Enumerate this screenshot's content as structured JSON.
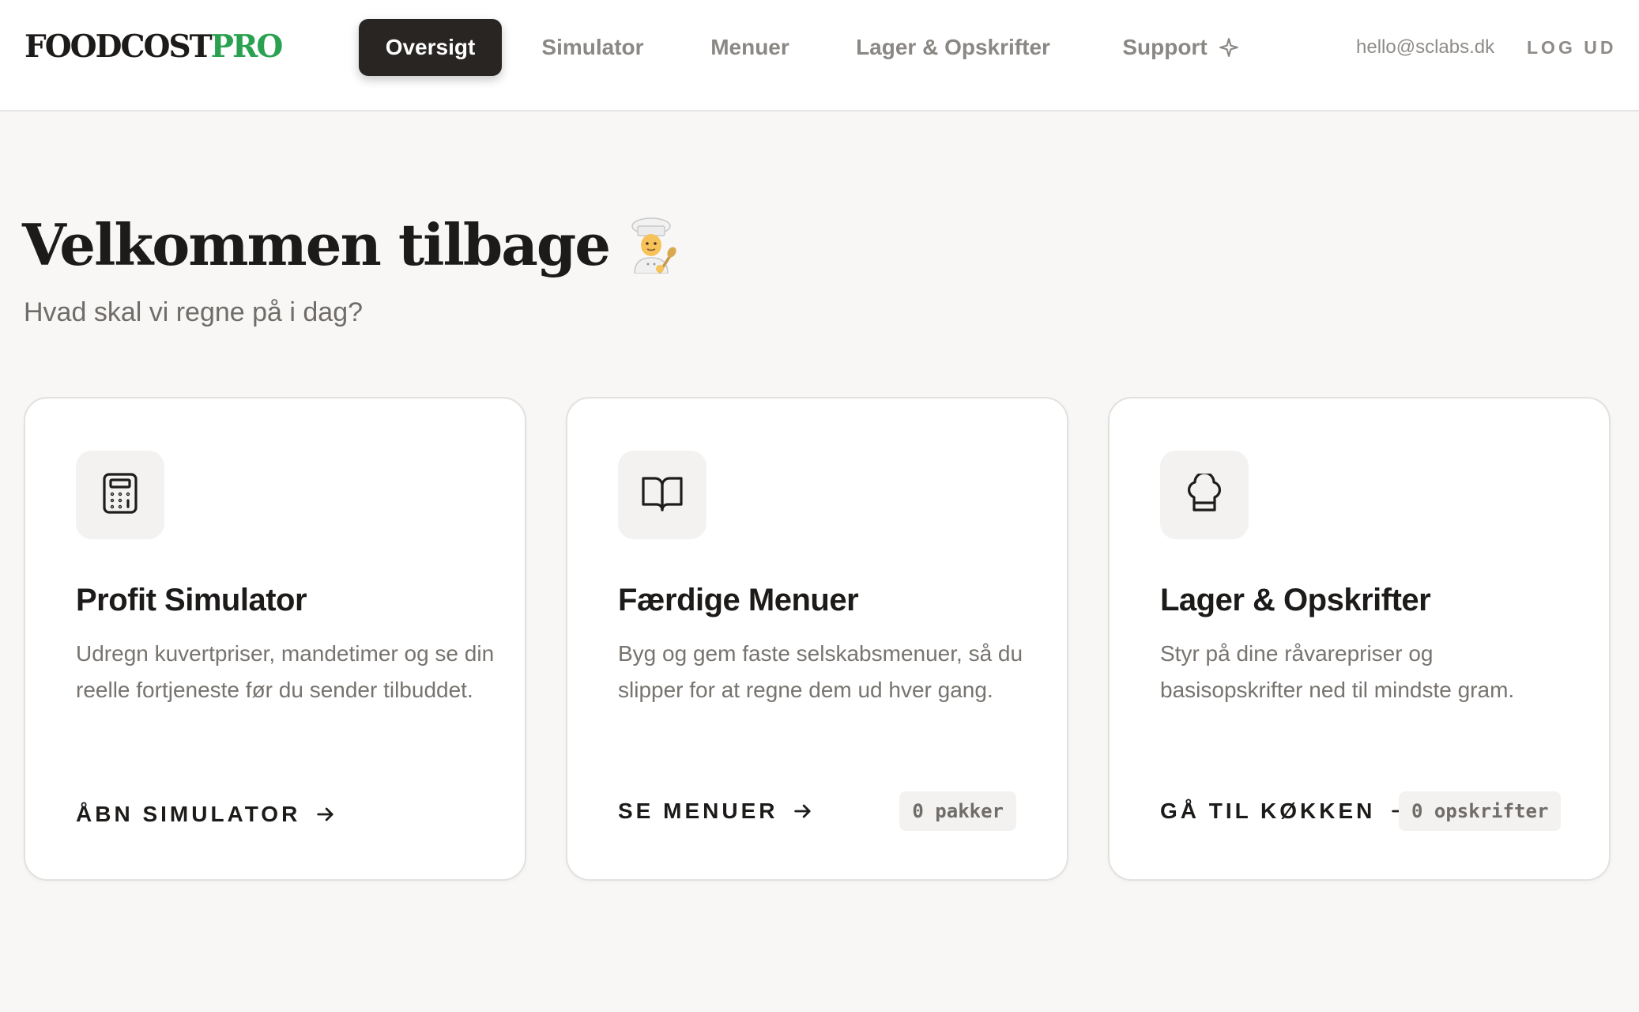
{
  "brand": {
    "part1": "FOODCOST",
    "part2": "PRO",
    "accent_color": "#2aa151"
  },
  "nav": {
    "tabs": [
      {
        "label": "Oversigt",
        "active": true
      },
      {
        "label": "Simulator",
        "active": false
      },
      {
        "label": "Menuer",
        "active": false
      },
      {
        "label": "Lager & Opskrifter",
        "active": false
      },
      {
        "label": "Support",
        "active": false,
        "icon": "sparkle-icon"
      }
    ],
    "user_email": "hello@sclabs.dk",
    "logout_label": "LOG UD"
  },
  "hero": {
    "title": "Velkommen tilbage",
    "title_icon": "chef-emoji",
    "subtitle": "Hvad skal vi regne på i dag?"
  },
  "cards": [
    {
      "icon": "calculator-icon",
      "title": "Profit Simulator",
      "description": "Udregn kuvertpriser, mandetimer og se din reelle fortjeneste før du sender tilbuddet.",
      "cta": "ÅBN SIMULATOR"
    },
    {
      "icon": "book-open-icon",
      "title": "Færdige Menuer",
      "description": "Byg og gem faste selskabsmenuer, så du slipper for at regne dem ud hver gang.",
      "cta": "SE MENUER",
      "count_label": "0 pakker"
    },
    {
      "icon": "chef-hat-icon",
      "title": "Lager & Opskrifter",
      "description": "Styr på dine råvarepriser og basisopskrifter ned til mindste gram.",
      "cta": "GÅ TIL KØKKEN",
      "count_label": "0 opskrifter"
    }
  ]
}
